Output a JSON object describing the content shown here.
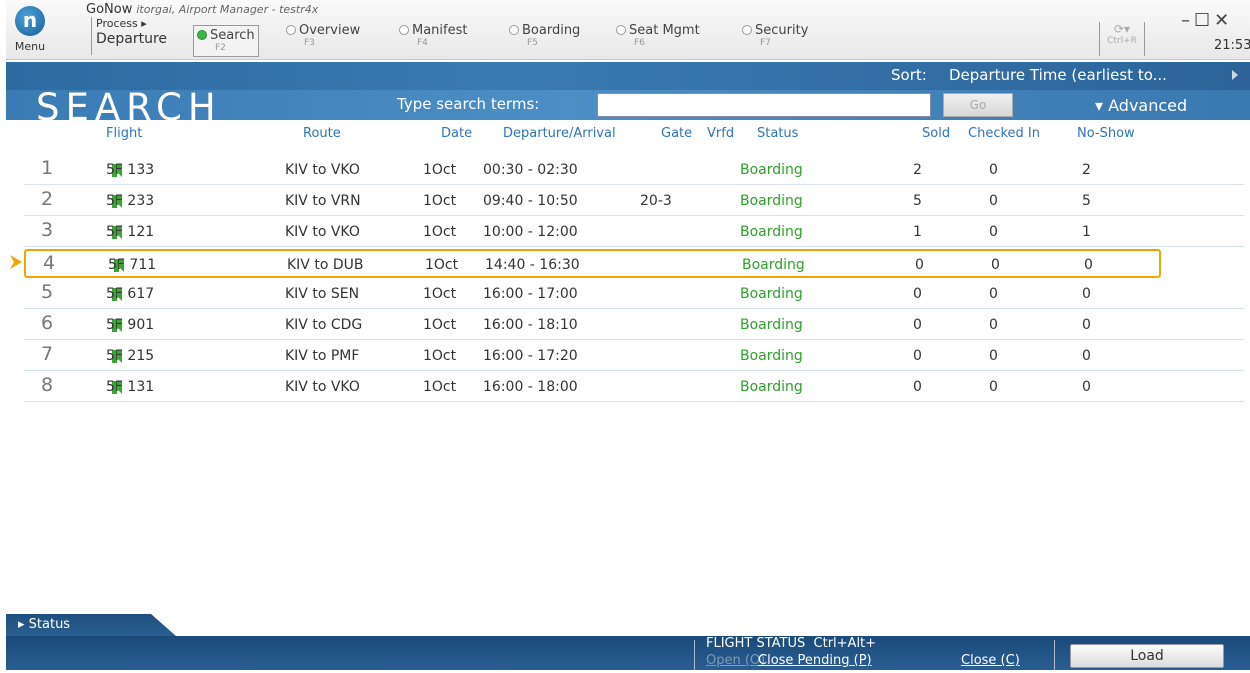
{
  "app": {
    "menu_logo": "n",
    "menu_label": "Menu",
    "name": "GoNow",
    "subtitle": "itorgai, Airport Manager - testr4x",
    "process_label": "Process ▸",
    "departure_label": "Departure"
  },
  "tabs": [
    {
      "label": "Search",
      "key": "F2",
      "active": true
    },
    {
      "label": "Overview",
      "key": "F3",
      "active": false
    },
    {
      "label": "Manifest",
      "key": "F4",
      "active": false
    },
    {
      "label": "Boarding",
      "key": "F5",
      "active": false
    },
    {
      "label": "Seat Mgmt",
      "key": "F6",
      "active": false
    },
    {
      "label": "Security",
      "key": "F7",
      "active": false
    }
  ],
  "toolbar": {
    "refresh_icon": "⟳▾",
    "refresh_shortcut": "Ctrl+R",
    "window_controls": "–☐✕",
    "clock": "21:53"
  },
  "sort": {
    "label": "Sort:",
    "value": "Departure Time (earliest to..."
  },
  "search": {
    "title": "SEARCH",
    "prompt": "Type search terms:",
    "input_value": "",
    "go_label": "Go",
    "advanced_label": "▾ Advanced"
  },
  "columns": {
    "flight": "Flight",
    "route": "Route",
    "date": "Date",
    "dep_arr": "Departure/Arrival",
    "gate": "Gate",
    "vrfd": "Vrfd",
    "status": "Status",
    "sold": "Sold",
    "checked_in": "Checked In",
    "no_show": "No-Show"
  },
  "rows": [
    {
      "n": "1",
      "flight": "5F 133",
      "route": "KIV to VKO",
      "date": "1Oct",
      "time": "00:30 - 02:30",
      "gate": "",
      "status": "Boarding",
      "sold": "2",
      "checked": "0",
      "noshow": "2"
    },
    {
      "n": "2",
      "flight": "5F 233",
      "route": "KIV to VRN",
      "date": "1Oct",
      "time": "09:40 - 10:50",
      "gate": "20-3",
      "status": "Boarding",
      "sold": "5",
      "checked": "0",
      "noshow": "5"
    },
    {
      "n": "3",
      "flight": "5F 121",
      "route": "KIV to VKO",
      "date": "1Oct",
      "time": "10:00 - 12:00",
      "gate": "",
      "status": "Boarding",
      "sold": "1",
      "checked": "0",
      "noshow": "1"
    },
    {
      "n": "4",
      "flight": "5F 711",
      "route": "KIV to DUB",
      "date": "1Oct",
      "time": "14:40 - 16:30",
      "gate": "",
      "status": "Boarding",
      "sold": "0",
      "checked": "0",
      "noshow": "0"
    },
    {
      "n": "5",
      "flight": "5F 617",
      "route": "KIV to SEN",
      "date": "1Oct",
      "time": "16:00 - 17:00",
      "gate": "",
      "status": "Boarding",
      "sold": "0",
      "checked": "0",
      "noshow": "0"
    },
    {
      "n": "6",
      "flight": "5F 901",
      "route": "KIV to CDG",
      "date": "1Oct",
      "time": "16:00 - 18:10",
      "gate": "",
      "status": "Boarding",
      "sold": "0",
      "checked": "0",
      "noshow": "0"
    },
    {
      "n": "7",
      "flight": "5F 215",
      "route": "KIV to PMF",
      "date": "1Oct",
      "time": "16:00 - 17:20",
      "gate": "",
      "status": "Boarding",
      "sold": "0",
      "checked": "0",
      "noshow": "0"
    },
    {
      "n": "8",
      "flight": "5F 131",
      "route": "KIV to VKO",
      "date": "1Oct",
      "time": "16:00 - 18:00",
      "gate": "",
      "status": "Boarding",
      "sold": "0",
      "checked": "0",
      "noshow": "0"
    }
  ],
  "selected_row_index": 3,
  "status_bar": {
    "tab_label": "▸ Status",
    "flight_status_label": "FLIGHT STATUS",
    "flight_status_shortcut": "Ctrl+Alt+",
    "open_label": "Open (O)",
    "close_pending_label": "Close Pending (P)",
    "close_label": "Close (C)",
    "load_label": "Load"
  },
  "colors": {
    "accent_blue": "#2f74b5",
    "status_green": "#2ea02a",
    "selection_orange": "#f0a400",
    "header_blue": "#3a7ab2"
  }
}
